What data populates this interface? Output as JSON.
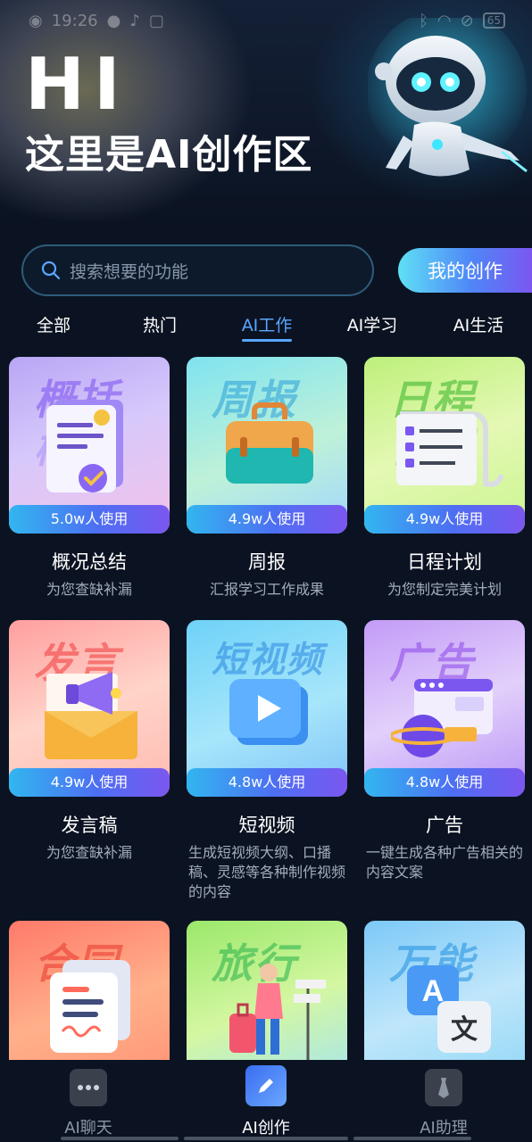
{
  "status_bar": {
    "time": "19:26",
    "battery": "65"
  },
  "hero": {
    "title": "HI",
    "subtitle": "这里是AI创作区"
  },
  "search": {
    "placeholder": "搜索想要的功能",
    "my_creation_label": "我的创作"
  },
  "tabs": [
    {
      "label": "全部",
      "active": false
    },
    {
      "label": "热门",
      "active": false
    },
    {
      "label": "AI工作",
      "active": true
    },
    {
      "label": "AI学习",
      "active": false
    },
    {
      "label": "AI生活",
      "active": false
    }
  ],
  "cards": [
    {
      "title": "概况总结",
      "desc": "为您查缺补漏",
      "usage": "5.0w人使用",
      "thumb_word": "概括",
      "icon": "document-check-icon"
    },
    {
      "title": "周报",
      "desc": "汇报学习工作成果",
      "usage": "4.9w人使用",
      "thumb_word": "周报",
      "icon": "briefcase-icon"
    },
    {
      "title": "日程计划",
      "desc": "为您制定完美计划",
      "usage": "4.9w人使用",
      "thumb_word": "日程",
      "icon": "checklist-scroll-icon"
    },
    {
      "title": "发言稿",
      "desc": "为您查缺补漏",
      "usage": "4.9w人使用",
      "thumb_word": "发言",
      "icon": "megaphone-envelope-icon"
    },
    {
      "title": "短视频",
      "desc": "生成短视频大纲、口播稿、灵感等各种制作视频的内容",
      "usage": "4.8w人使用",
      "thumb_word": "短视频",
      "icon": "play-button-icon"
    },
    {
      "title": "广告",
      "desc": "一键生成各种广告相关的内容文案",
      "usage": "4.8w人使用",
      "thumb_word": "广告",
      "icon": "ads-browser-planet-icon"
    },
    {
      "title": "",
      "desc": "",
      "usage": "",
      "thumb_word": "合同",
      "icon": "contract-document-icon"
    },
    {
      "title": "",
      "desc": "",
      "usage": "",
      "thumb_word": "旅行",
      "icon": "traveler-suitcase-icon"
    },
    {
      "title": "",
      "desc": "",
      "usage": "",
      "thumb_word": "万能",
      "icon": "translate-icon"
    }
  ],
  "bottom_nav": [
    {
      "label": "AI聊天",
      "icon": "chat-bubble-icon",
      "active": false
    },
    {
      "label": "AI创作",
      "icon": "pen-icon",
      "active": true
    },
    {
      "label": "AI助理",
      "icon": "tie-icon",
      "active": false
    }
  ],
  "colors": {
    "background": "#0b1322",
    "accent": "#5aa7ff",
    "usage_gradient": [
      "#32b6f0",
      "#4d6ff2",
      "#7b57f0"
    ]
  }
}
